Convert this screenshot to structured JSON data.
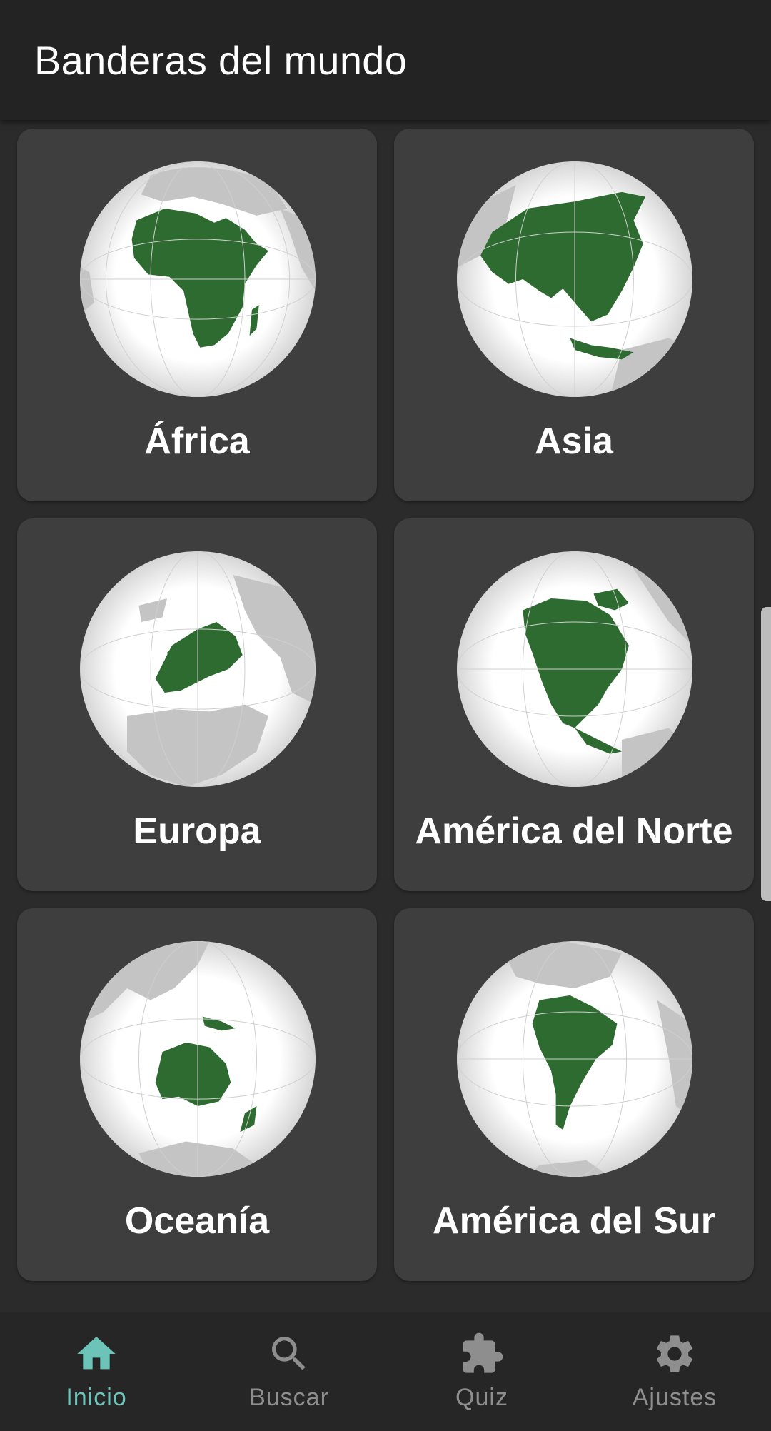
{
  "app_bar": {
    "title": "Banderas del mundo"
  },
  "regions": [
    {
      "label": "África",
      "icon": "africa-globe-icon"
    },
    {
      "label": "Asia",
      "icon": "asia-globe-icon"
    },
    {
      "label": "Europa",
      "icon": "europe-globe-icon"
    },
    {
      "label": "América del Norte",
      "icon": "north-america-globe-icon"
    },
    {
      "label": "Oceanía",
      "icon": "oceania-globe-icon"
    },
    {
      "label": "América del Sur",
      "icon": "south-america-globe-icon"
    }
  ],
  "bottom_nav": {
    "items": [
      {
        "label": "Inicio",
        "icon": "home-icon",
        "active": true
      },
      {
        "label": "Buscar",
        "icon": "search-icon",
        "active": false
      },
      {
        "label": "Quiz",
        "icon": "puzzle-icon",
        "active": false
      },
      {
        "label": "Ajustes",
        "icon": "gear-icon",
        "active": false
      }
    ]
  },
  "colors": {
    "background": "#2b2b2b",
    "app_bar": "#232323",
    "card": "#3e3e3e",
    "continent_highlight": "#2e6b30",
    "land_other": "#b5b5b5",
    "accent": "#6cc3b8",
    "nav_inactive": "#8e8e8e"
  }
}
